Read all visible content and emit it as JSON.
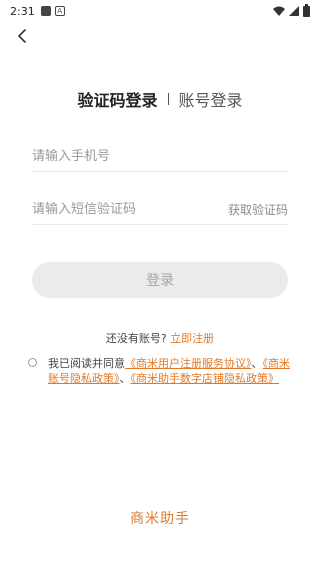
{
  "status_bar": {
    "time": "2:31",
    "notif_icon": "A"
  },
  "tabs": {
    "active": "验证码登录",
    "inactive": "账号登录"
  },
  "phone": {
    "placeholder": "请输入手机号"
  },
  "code": {
    "placeholder": "请输入短信验证码",
    "get_code_label": "获取验证码"
  },
  "login_button": "登录",
  "register": {
    "prompt": "还没有账号?",
    "link": "立即注册"
  },
  "agreement": {
    "prefix": "我已阅读并同意",
    "policy1": "《商米用户注册服务协议》",
    "sep1": "、",
    "policy2": "《商米账号隐私政策》",
    "sep2": "、",
    "policy3": "《商米助手数字店铺隐私政策》"
  },
  "brand": "商米助手",
  "colors": {
    "accent": "#e07a2a",
    "button_bg": "#ebebeb"
  }
}
